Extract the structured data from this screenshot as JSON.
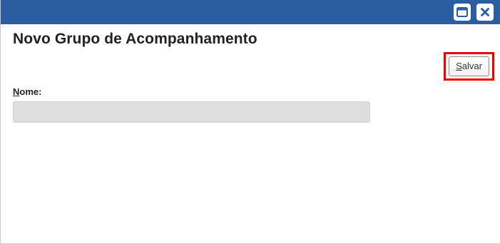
{
  "window": {
    "title_bar_color": "#2b5ea0",
    "buttons": [
      {
        "name": "maximize",
        "icon": "window-maximize-icon"
      },
      {
        "name": "close",
        "icon": "close-icon"
      }
    ]
  },
  "form": {
    "title": "Novo Grupo de Acompanhamento",
    "save": {
      "accesskey_char": "S",
      "rest": "alvar",
      "highlight_color": "#ee0000"
    },
    "name_field": {
      "accesskey_char": "N",
      "rest": "ome:",
      "value": "",
      "placeholder": ""
    }
  }
}
